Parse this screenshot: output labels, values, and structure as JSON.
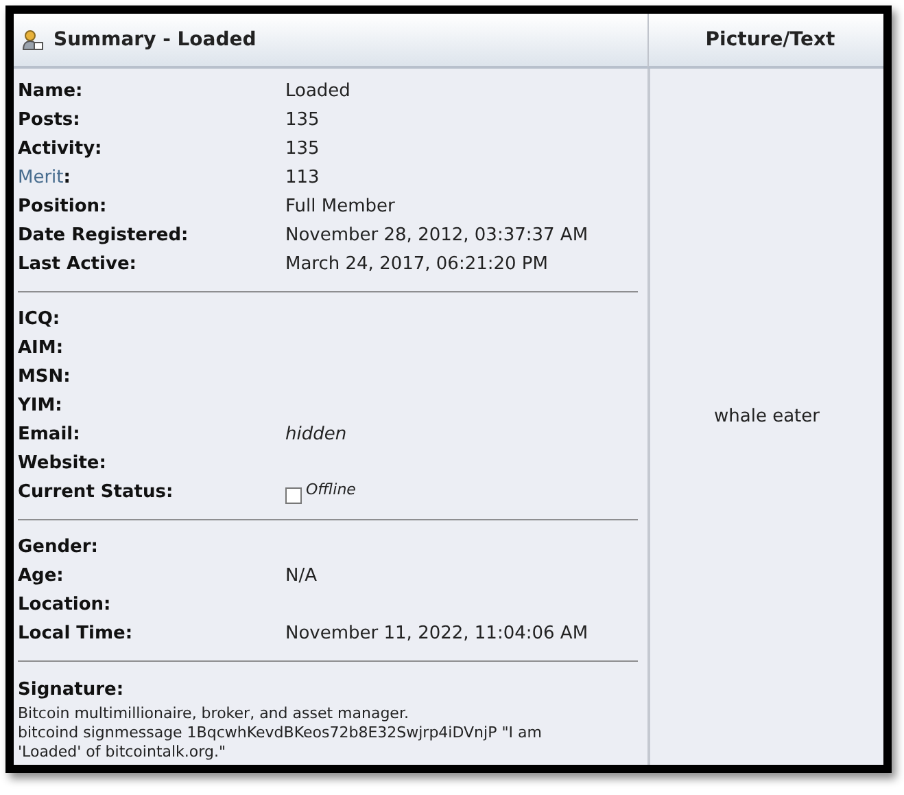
{
  "summary": {
    "title": "Summary - Loaded"
  },
  "picture_text": {
    "heading": "Picture/Text",
    "text": "whale eater"
  },
  "sections": [
    {
      "rows": [
        {
          "label": "Name:",
          "value": "Loaded",
          "kind": "text"
        },
        {
          "label": "Posts:",
          "value": "135",
          "kind": "text"
        },
        {
          "label": "Activity:",
          "value": "135",
          "kind": "text"
        },
        {
          "label": "Merit",
          "label_suffix": ":",
          "label_link": true,
          "value": "113",
          "kind": "text"
        },
        {
          "label": "Position:",
          "value": "Full Member",
          "kind": "text"
        },
        {
          "label": "Date Registered:",
          "value": "November 28, 2012, 03:37:37 AM",
          "kind": "text"
        },
        {
          "label": "Last Active:",
          "value": "March 24, 2017, 06:21:20 PM",
          "kind": "text"
        }
      ]
    },
    {
      "rows": [
        {
          "label": "ICQ:"
        },
        {
          "label": "AIM:"
        },
        {
          "label": "MSN:"
        },
        {
          "label": "YIM:"
        },
        {
          "label": "Email:",
          "value": "hidden",
          "kind": "italic"
        },
        {
          "label": "Website:"
        },
        {
          "label": "Current Status:",
          "value": "Offline",
          "kind": "status"
        }
      ]
    },
    {
      "rows": [
        {
          "label": "Gender:"
        },
        {
          "label": "Age:",
          "value": "N/A",
          "kind": "text"
        },
        {
          "label": "Location:"
        },
        {
          "label": "Local Time:",
          "value": "November 11, 2022, 11:04:06 AM",
          "kind": "text"
        }
      ]
    }
  ],
  "signature": {
    "label": "Signature:",
    "lines": [
      "Bitcoin multimillionaire, broker, and asset manager.",
      "bitcoind signmessage 1BqcwhKevdBKeos72b8E32Swjrp4iDVnjP \"I am",
      "'Loaded' of bitcointalk.org.\""
    ]
  }
}
